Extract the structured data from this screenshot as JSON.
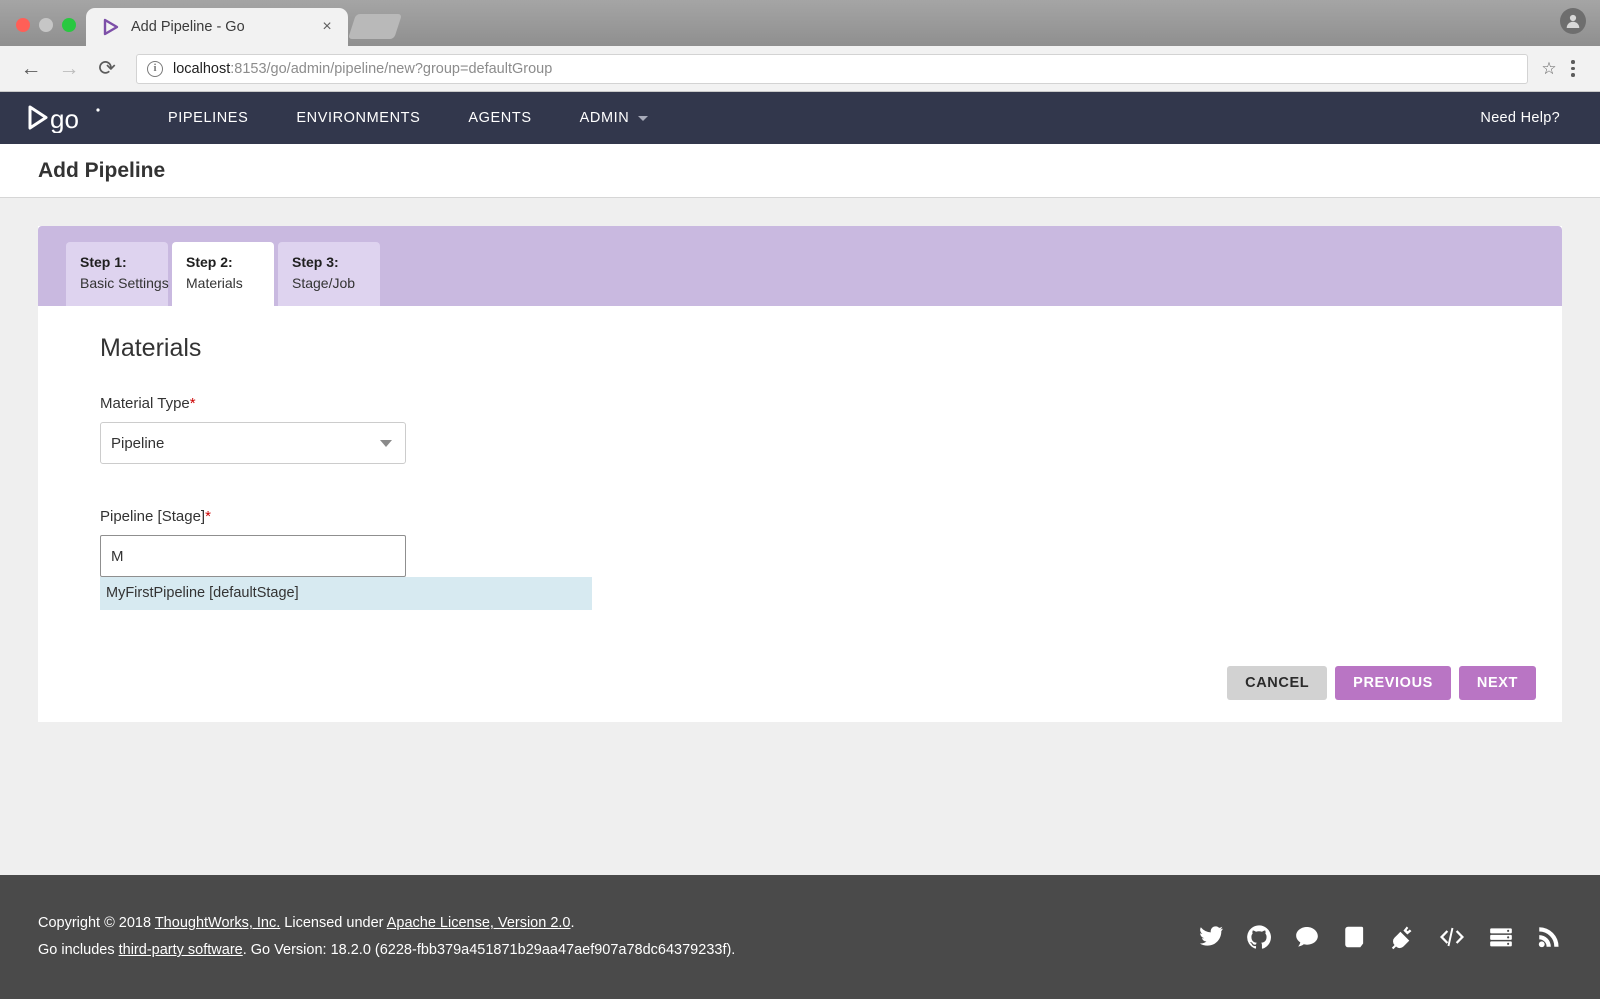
{
  "browser": {
    "tab": {
      "title": "Add Pipeline - Go",
      "favicon": "go-play-icon",
      "close_label": "×"
    },
    "new_tab_label": "",
    "back_label": "←",
    "forward_label": "→",
    "reload_label": "⟳",
    "site_info_label": "i",
    "url_host": "localhost",
    "url_rest": ":8153/go/admin/pipeline/new?group=defaultGroup",
    "bookmark_label": "☆",
    "menu_label": "kebab-menu-icon",
    "profile_label": "profile-icon"
  },
  "header": {
    "logo_text": "go",
    "nav": [
      {
        "label": "PIPELINES",
        "name": "nav-pipelines"
      },
      {
        "label": "ENVIRONMENTS",
        "name": "nav-environments"
      },
      {
        "label": "AGENTS",
        "name": "nav-agents"
      },
      {
        "label": "ADMIN",
        "name": "nav-admin",
        "has_caret": true
      }
    ],
    "need_help": "Need Help?"
  },
  "page": {
    "title": "Add Pipeline"
  },
  "wizard": {
    "steps": [
      {
        "line1": "Step 1:",
        "line2": "Basic Settings",
        "active": false
      },
      {
        "line1": "Step 2:",
        "line2": "Materials",
        "active": true
      },
      {
        "line1": "Step 3:",
        "line2": "Stage/Job",
        "active": false
      }
    ]
  },
  "form": {
    "section_title": "Materials",
    "material_type": {
      "label": "Material Type",
      "required_marker": "*",
      "value": "Pipeline",
      "options": [
        "Pipeline"
      ]
    },
    "pipeline_stage": {
      "label": "Pipeline [Stage]",
      "required_marker": "*",
      "value": "M",
      "placeholder": "",
      "suggestions": [
        "MyFirstPipeline [defaultStage]"
      ]
    }
  },
  "actions": {
    "cancel": "CANCEL",
    "previous": "PREVIOUS",
    "next": "NEXT"
  },
  "footer": {
    "line1_prefix": "Copyright © 2018 ",
    "line1_link1": "ThoughtWorks, Inc.",
    "line1_mid": " Licensed under ",
    "line1_link2": "Apache License, Version 2.0",
    "line1_suffix": ".",
    "line2_prefix": "Go includes ",
    "line2_link": "third-party software",
    "line2_suffix": ". Go Version: 18.2.0 (6228-fbb379a451871b29aa47aef907a78dc64379233f).",
    "icons": [
      "twitter-icon",
      "github-icon",
      "chat-icon",
      "book-icon",
      "plug-icon",
      "code-icon",
      "server-icon",
      "rss-icon"
    ]
  },
  "colors": {
    "nav_bg": "#32374c",
    "wizard_strip": "#c9b9e0",
    "wizard_tab_inactive": "#ded3ef",
    "accent_purple": "#b975c4",
    "autocomplete_highlight": "#d7eaf1",
    "required": "#cc0000",
    "footer_bg": "#4a4a4a"
  }
}
